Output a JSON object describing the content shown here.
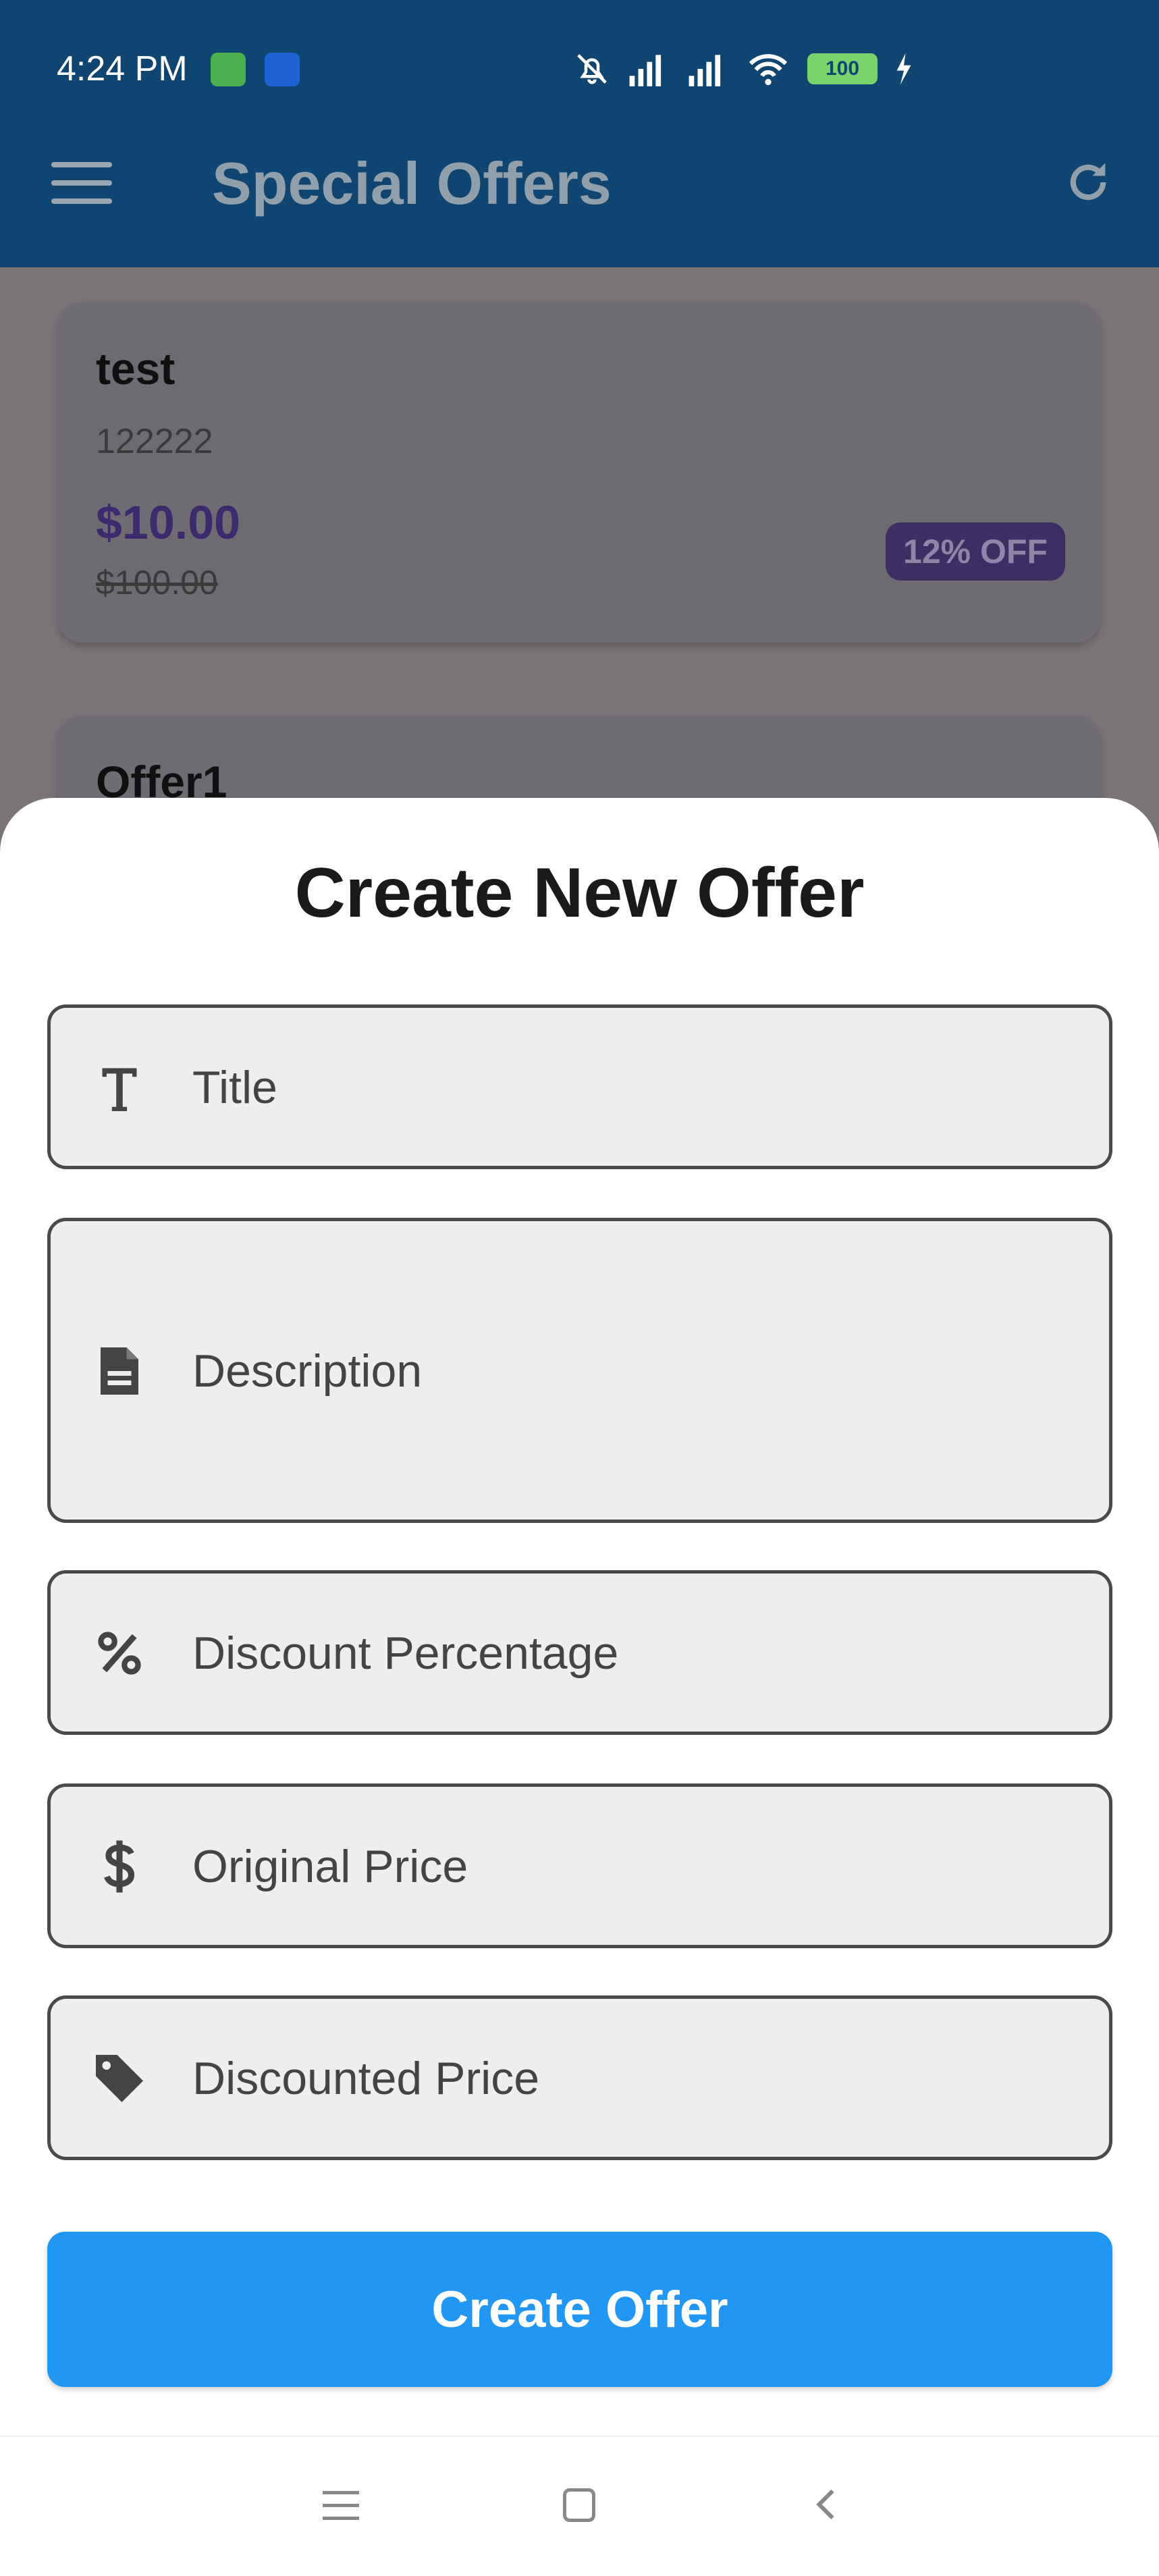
{
  "status_bar": {
    "time": "4:24 PM",
    "battery": "100"
  },
  "app_bar": {
    "title": "Special Offers"
  },
  "offers": [
    {
      "title": "test",
      "description": "122222",
      "price": "$10.00",
      "original_price": "$100.00",
      "badge": "12% OFF"
    },
    {
      "title": "Offer1"
    }
  ],
  "sheet": {
    "title": "Create New Offer",
    "fields": {
      "title": "Title",
      "description": "Description",
      "discount_percentage": "Discount Percentage",
      "original_price": "Original Price",
      "discounted_price": "Discounted Price"
    },
    "submit_label": "Create Offer"
  },
  "colors": {
    "app_bar": "#0f4571",
    "primary_button": "#2196f3",
    "sheet_bg": "#ffffff",
    "field_bg": "#eeeeee"
  },
  "icons": [
    "menu-icon",
    "refresh-icon",
    "text-title-icon",
    "document-icon",
    "percent-icon",
    "dollar-icon",
    "tag-icon"
  ]
}
